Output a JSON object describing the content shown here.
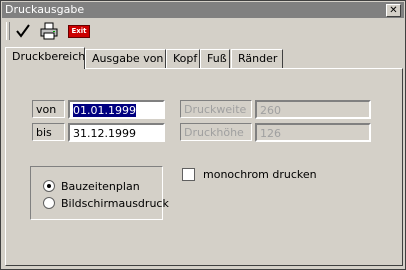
{
  "window": {
    "title": "Druckausgabe",
    "close_label": "✕"
  },
  "toolbar": {
    "exit_label": "Exit"
  },
  "tabs": [
    {
      "label": "Druckbereich",
      "active": true
    },
    {
      "label": "Ausgabe von"
    },
    {
      "label": "Kopf"
    },
    {
      "label": "Fuß"
    },
    {
      "label": "Ränder"
    }
  ],
  "range": {
    "from_label": "von",
    "from_value": "01.01.1999",
    "to_label": "bis",
    "to_value": "31.12.1999"
  },
  "print_size": {
    "width_label": "Druckweite",
    "width_value": "260",
    "height_label": "Druckhöhe",
    "height_value": "126"
  },
  "mode": {
    "options": [
      "Bauzeitenplan",
      "Bildschirmausdruck"
    ],
    "selected": "Bauzeitenplan"
  },
  "monochrome": {
    "label": "monochrom drucken",
    "checked": false
  },
  "colors": {
    "titlebar": "#808080",
    "selection": "#000080",
    "face": "#d4d0c8",
    "exit_button": "#cc0000"
  }
}
